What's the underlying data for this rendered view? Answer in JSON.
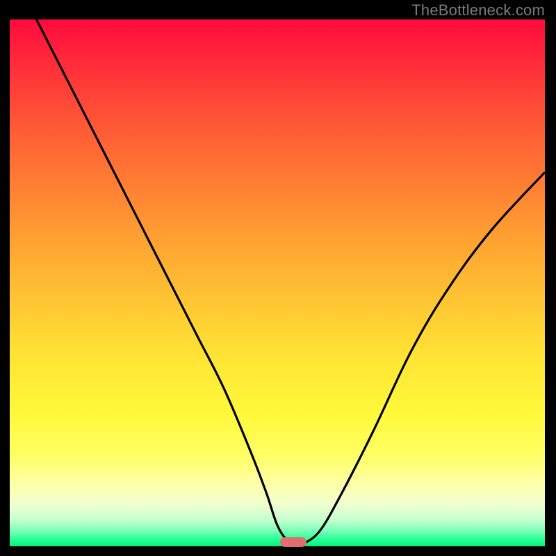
{
  "attribution": "TheBottleneck.com",
  "colors": {
    "curve_stroke": "#000000",
    "marker_fill": "#e06e6e"
  },
  "chart_data": {
    "type": "line",
    "title": "",
    "xlabel": "",
    "ylabel": "",
    "xlim": [
      0,
      100
    ],
    "ylim": [
      0,
      100
    ],
    "grid": false,
    "legend": false,
    "note": "No axes or tick labels are rendered in the source image; x/y values below are estimated from pixel positions on a 0–100 normalized scale. y represents bottleneck percentage (0 = green/good, 100 = red/bad).",
    "series": [
      {
        "name": "bottleneck-curve",
        "x": [
          5,
          10,
          15,
          20,
          25,
          30,
          35,
          40,
          45,
          48,
          50,
          52,
          54,
          55,
          58,
          62,
          68,
          75,
          82,
          90,
          100
        ],
        "y": [
          100,
          90,
          80,
          70,
          60,
          50,
          40,
          30,
          18,
          10,
          4,
          1,
          0,
          0.5,
          3,
          10,
          22,
          37,
          49,
          60,
          71
        ]
      }
    ],
    "marker": {
      "name": "optimal-point",
      "x": 53,
      "y": 0
    }
  }
}
